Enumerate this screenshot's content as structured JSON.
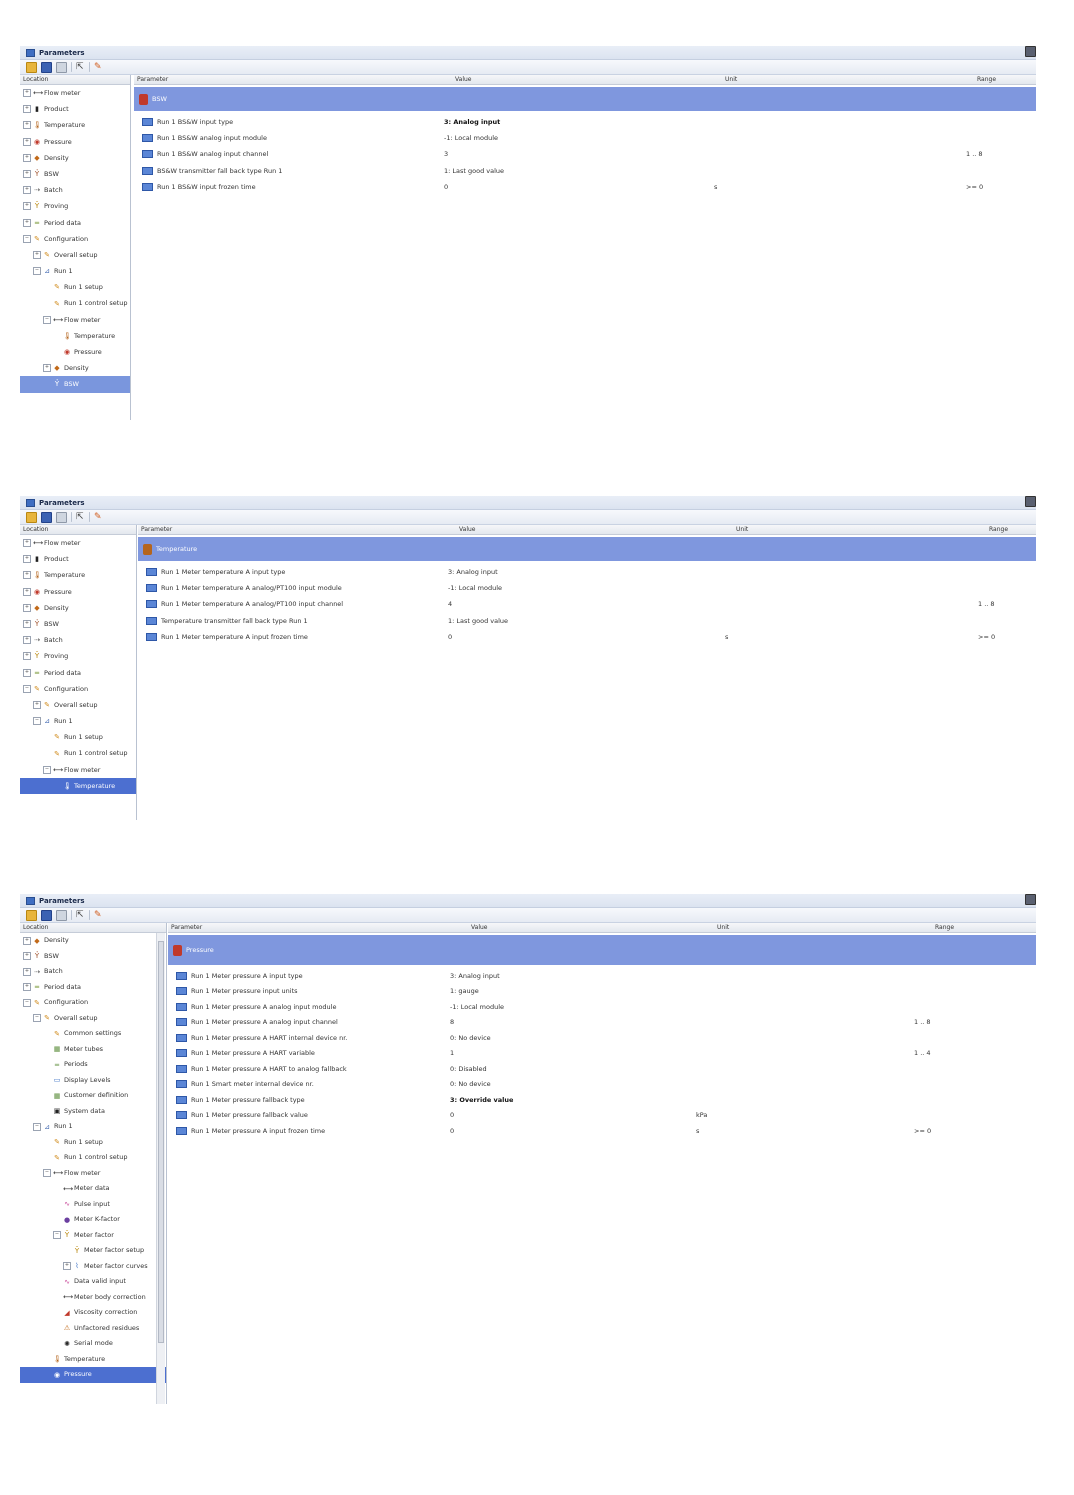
{
  "panels": [
    {
      "title": "Parameters",
      "tree_header": "Location",
      "columns": [
        "Parameter",
        "Value",
        "Unit",
        "Range"
      ],
      "tree": [
        {
          "exp": "+",
          "icon": "flow-meter-icon",
          "label": "Flow meter"
        },
        {
          "exp": "+",
          "icon": "product-icon",
          "label": "Product"
        },
        {
          "exp": "+",
          "icon": "thermometer-icon",
          "label": "Temperature"
        },
        {
          "exp": "+",
          "icon": "pressure-gauge-icon",
          "label": "Pressure"
        },
        {
          "exp": "+",
          "icon": "density-icon",
          "label": "Density"
        },
        {
          "exp": "+",
          "icon": "bsw-icon",
          "label": "BSW"
        },
        {
          "exp": "+",
          "icon": "batch-icon",
          "label": "Batch"
        },
        {
          "exp": "+",
          "icon": "proving-icon",
          "label": "Proving"
        },
        {
          "exp": "+",
          "icon": "period-data-icon",
          "label": "Period data"
        },
        {
          "exp": "-",
          "icon": "configuration-icon",
          "label": "Configuration"
        },
        {
          "exp": "+",
          "icon": "wrench-icon",
          "label": "Overall setup",
          "indent": 1
        },
        {
          "exp": "-",
          "icon": "run-icon",
          "label": "Run 1",
          "indent": 1
        },
        {
          "exp": "",
          "icon": "wrench-icon",
          "label": "Run 1 setup",
          "indent": 2
        },
        {
          "exp": "",
          "icon": "wrench-icon",
          "label": "Run 1 control setup",
          "indent": 2
        },
        {
          "exp": "-",
          "icon": "flow-meter-icon",
          "label": "Flow meter",
          "indent": 2
        },
        {
          "exp": "",
          "icon": "thermometer-icon",
          "label": "Temperature",
          "indent": 3
        },
        {
          "exp": "",
          "icon": "pressure-gauge-icon",
          "label": "Pressure",
          "indent": 3
        },
        {
          "exp": "+",
          "icon": "density-icon",
          "label": "Density",
          "indent": 2
        },
        {
          "exp": "",
          "icon": "bsw-icon",
          "label": "BSW",
          "indent": 2,
          "selected": true
        }
      ],
      "group": {
        "label": "BSW",
        "icon_color": "#c0392b"
      },
      "rows": [
        {
          "param": "Run 1 BS&W input type",
          "value": "3: Analog input",
          "unit": "",
          "range": "",
          "bold": true
        },
        {
          "param": "Run 1 BS&W analog input module",
          "value": "-1: Local module",
          "unit": "",
          "range": ""
        },
        {
          "param": "Run 1 BS&W analog input channel",
          "value": "3",
          "unit": "",
          "range": "1 .. 8"
        },
        {
          "param": "BS&W transmitter fall back type Run 1",
          "value": "1: Last good value",
          "unit": "",
          "range": ""
        },
        {
          "param": "Run 1 BS&W input frozen time",
          "value": "0",
          "unit": "s",
          "range": ">= 0"
        }
      ]
    },
    {
      "title": "Parameters",
      "tree_header": "Location",
      "columns": [
        "Parameter",
        "Value",
        "Unit",
        "Range"
      ],
      "tree": [
        {
          "exp": "+",
          "icon": "flow-meter-icon",
          "label": "Flow meter"
        },
        {
          "exp": "+",
          "icon": "product-icon",
          "label": "Product"
        },
        {
          "exp": "+",
          "icon": "thermometer-icon",
          "label": "Temperature"
        },
        {
          "exp": "+",
          "icon": "pressure-gauge-icon",
          "label": "Pressure"
        },
        {
          "exp": "+",
          "icon": "density-icon",
          "label": "Density"
        },
        {
          "exp": "+",
          "icon": "bsw-icon",
          "label": "BSW"
        },
        {
          "exp": "+",
          "icon": "batch-icon",
          "label": "Batch"
        },
        {
          "exp": "+",
          "icon": "proving-icon",
          "label": "Proving"
        },
        {
          "exp": "+",
          "icon": "period-data-icon",
          "label": "Period data"
        },
        {
          "exp": "-",
          "icon": "configuration-icon",
          "label": "Configuration"
        },
        {
          "exp": "+",
          "icon": "wrench-icon",
          "label": "Overall setup",
          "indent": 1
        },
        {
          "exp": "-",
          "icon": "run-icon",
          "label": "Run 1",
          "indent": 1
        },
        {
          "exp": "",
          "icon": "wrench-icon",
          "label": "Run 1 setup",
          "indent": 2
        },
        {
          "exp": "",
          "icon": "wrench-icon",
          "label": "Run 1 control setup",
          "indent": 2
        },
        {
          "exp": "-",
          "icon": "flow-meter-icon",
          "label": "Flow meter",
          "indent": 2
        },
        {
          "exp": "",
          "icon": "thermometer-icon",
          "label": "Temperature",
          "indent": 3,
          "selected": true
        }
      ],
      "group": {
        "label": "Temperature",
        "icon_color": "#b5651d"
      },
      "rows": [
        {
          "param": "Run 1 Meter temperature A input type",
          "value": "3: Analog input",
          "unit": "",
          "range": ""
        },
        {
          "param": "Run 1 Meter temperature A analog/PT100 input module",
          "value": "-1: Local module",
          "unit": "",
          "range": ""
        },
        {
          "param": "Run 1 Meter temperature A analog/PT100 input channel",
          "value": "4",
          "unit": "",
          "range": "1 .. 8"
        },
        {
          "param": "Temperature transmitter fall back type Run 1",
          "value": "1: Last good value",
          "unit": "",
          "range": ""
        },
        {
          "param": "Run 1 Meter temperature A input frozen time",
          "value": "0",
          "unit": "s",
          "range": ">= 0"
        }
      ]
    },
    {
      "title": "Parameters",
      "tree_header": "Location",
      "columns": [
        "Parameter",
        "Value",
        "Unit",
        "Range"
      ],
      "tree": [
        {
          "exp": "+",
          "icon": "density-icon",
          "label": "Density"
        },
        {
          "exp": "+",
          "icon": "bsw-icon",
          "label": "BSW"
        },
        {
          "exp": "+",
          "icon": "batch-icon",
          "label": "Batch"
        },
        {
          "exp": "+",
          "icon": "period-data-icon",
          "label": "Period data"
        },
        {
          "exp": "-",
          "icon": "configuration-icon",
          "label": "Configuration"
        },
        {
          "exp": "-",
          "icon": "wrench-icon",
          "label": "Overall setup",
          "indent": 1
        },
        {
          "exp": "",
          "icon": "wrench-icon",
          "label": "Common settings",
          "indent": 2
        },
        {
          "exp": "",
          "icon": "meter-icon",
          "label": "Meter tubes",
          "indent": 2
        },
        {
          "exp": "",
          "icon": "periods-icon",
          "label": "Periods",
          "indent": 2
        },
        {
          "exp": "",
          "icon": "display-icon",
          "label": "Display Levels",
          "indent": 2
        },
        {
          "exp": "",
          "icon": "customer-icon",
          "label": "Customer definition",
          "indent": 2
        },
        {
          "exp": "",
          "icon": "system-icon",
          "label": "System data",
          "indent": 2
        },
        {
          "exp": "-",
          "icon": "run-icon",
          "label": "Run 1",
          "indent": 1
        },
        {
          "exp": "",
          "icon": "wrench-icon",
          "label": "Run 1 setup",
          "indent": 2
        },
        {
          "exp": "",
          "icon": "wrench-icon",
          "label": "Run 1 control setup",
          "indent": 2
        },
        {
          "exp": "-",
          "icon": "flow-meter-icon",
          "label": "Flow meter",
          "indent": 2
        },
        {
          "exp": "",
          "icon": "flow-meter-icon",
          "label": "Meter data",
          "indent": 3
        },
        {
          "exp": "",
          "icon": "pulse-icon",
          "label": "Pulse input",
          "indent": 3
        },
        {
          "exp": "",
          "icon": "k-factor-icon",
          "label": "Meter K-factor",
          "indent": 3
        },
        {
          "exp": "-",
          "icon": "factor-icon",
          "label": "Meter factor",
          "indent": 3
        },
        {
          "exp": "",
          "icon": "factor-icon",
          "label": "Meter factor setup",
          "indent": 4
        },
        {
          "exp": "+",
          "icon": "curve-icon",
          "label": "Meter factor curves",
          "indent": 4
        },
        {
          "exp": "",
          "icon": "valid-icon",
          "label": "Data valid input",
          "indent": 3
        },
        {
          "exp": "",
          "icon": "flow-meter-icon",
          "label": "Meter body correction",
          "indent": 3
        },
        {
          "exp": "",
          "icon": "viscosity-icon",
          "label": "Viscosity correction",
          "indent": 3
        },
        {
          "exp": "",
          "icon": "warning-icon",
          "label": "Unfactored residues",
          "indent": 3
        },
        {
          "exp": "",
          "icon": "serial-icon",
          "label": "Serial mode",
          "indent": 3
        },
        {
          "exp": "",
          "icon": "thermometer-icon",
          "label": "Temperature",
          "indent": 2
        },
        {
          "exp": "",
          "icon": "pressure-gauge-icon",
          "label": "Pressure",
          "indent": 2,
          "selected": true
        }
      ],
      "group": {
        "label": "Pressure",
        "icon_color": "#c0392b"
      },
      "rows": [
        {
          "param": "Run 1 Meter pressure A input type",
          "value": "3: Analog input",
          "unit": "",
          "range": ""
        },
        {
          "param": "Run 1 Meter pressure input units",
          "value": "1: gauge",
          "unit": "",
          "range": ""
        },
        {
          "param": "Run 1 Meter pressure A analog input module",
          "value": "-1: Local module",
          "unit": "",
          "range": ""
        },
        {
          "param": "Run 1 Meter pressure A analog input channel",
          "value": "8",
          "unit": "",
          "range": "1 .. 8"
        },
        {
          "param": "Run 1 Meter pressure A HART internal device nr.",
          "value": "0: No device",
          "unit": "",
          "range": ""
        },
        {
          "param": "Run 1 Meter pressure A HART variable",
          "value": "1",
          "unit": "",
          "range": "1 .. 4"
        },
        {
          "param": "Run 1 Meter pressure A HART to analog fallback",
          "value": "0: Disabled",
          "unit": "",
          "range": ""
        },
        {
          "param": "Run 1 Smart meter internal device nr.",
          "value": "0: No device",
          "unit": "",
          "range": ""
        },
        {
          "param": "Run 1 Meter pressure fallback type",
          "value": "3: Override value",
          "unit": "",
          "range": "",
          "bold": true
        },
        {
          "param": "Run 1 Meter pressure fallback value",
          "value": "0",
          "unit": "kPa",
          "range": ""
        },
        {
          "param": "Run 1 Meter pressure A input frozen time",
          "value": "0",
          "unit": "s",
          "range": ">= 0"
        }
      ]
    }
  ]
}
